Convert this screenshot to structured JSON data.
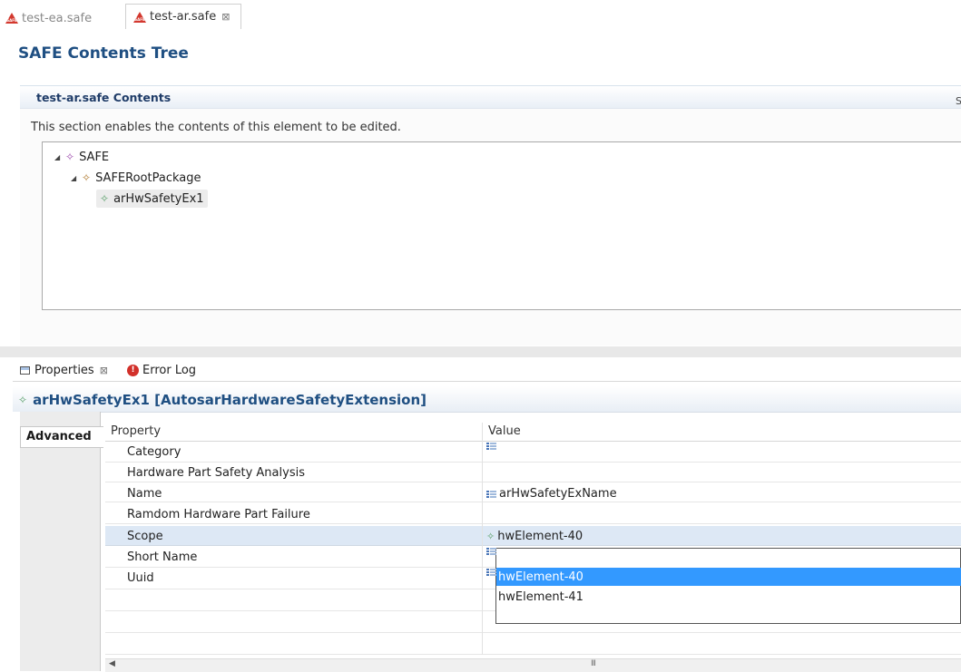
{
  "editor_tabs": [
    {
      "label": "test-ea.safe",
      "icon": "safe-file-icon",
      "active": false
    },
    {
      "label": "test-ar.safe",
      "icon": "safe-file-icon",
      "active": true,
      "close_glyph": "⊠"
    }
  ],
  "editor": {
    "page_title": "SAFE Contents Tree",
    "section_title": "test-ar.safe Contents",
    "section_right_letter": "S",
    "section_description": "This section enables the contents of this element to be edited.",
    "tree": [
      {
        "label": "SAFE",
        "expanded": true,
        "color": "#a050b0"
      },
      {
        "label": "SAFERootPackage",
        "expanded": true,
        "color": "#b07a30"
      },
      {
        "label": "arHwSafetyEx1",
        "expanded": false,
        "color": "#5aa06a",
        "selected": true
      }
    ]
  },
  "properties_view": {
    "tabs": [
      {
        "label": "Properties",
        "icon": "properties-view-icon",
        "active": true,
        "close_glyph": "⊠"
      },
      {
        "label": "Error Log",
        "icon": "error-log-icon",
        "active": false
      }
    ],
    "selection_title": "arHwSafetyEx1 [AutosarHardwareSafetyExtension]",
    "side_tab": "Advanced",
    "columns": {
      "property": "Property",
      "value": "Value"
    },
    "rows": [
      {
        "property": "Category",
        "value": "",
        "value_icon": "text-value-icon"
      },
      {
        "property": "Hardware Part Safety Analysis",
        "value": "",
        "value_icon": ""
      },
      {
        "property": "Name",
        "value": "arHwSafetyExName",
        "value_icon": "text-value-icon"
      },
      {
        "property": "Ramdom Hardware Part Failure",
        "value": "",
        "value_icon": ""
      },
      {
        "property": "Scope",
        "value": "hwElement-40",
        "value_icon": "element-icon",
        "selected": true
      },
      {
        "property": "Short Name",
        "value": "",
        "value_icon": "text-value-icon"
      },
      {
        "property": "Uuid",
        "value": "",
        "value_icon": "text-value-icon"
      }
    ],
    "dropdown_options": [
      "hwElement-40",
      "hwElement-41"
    ],
    "dropdown_selected": "hwElement-40",
    "scrollbar_grip": "III"
  },
  "colors": {
    "title_blue": "#1f4f82",
    "selection_blue": "#3399ff",
    "row_selected": "#dde8f5"
  }
}
